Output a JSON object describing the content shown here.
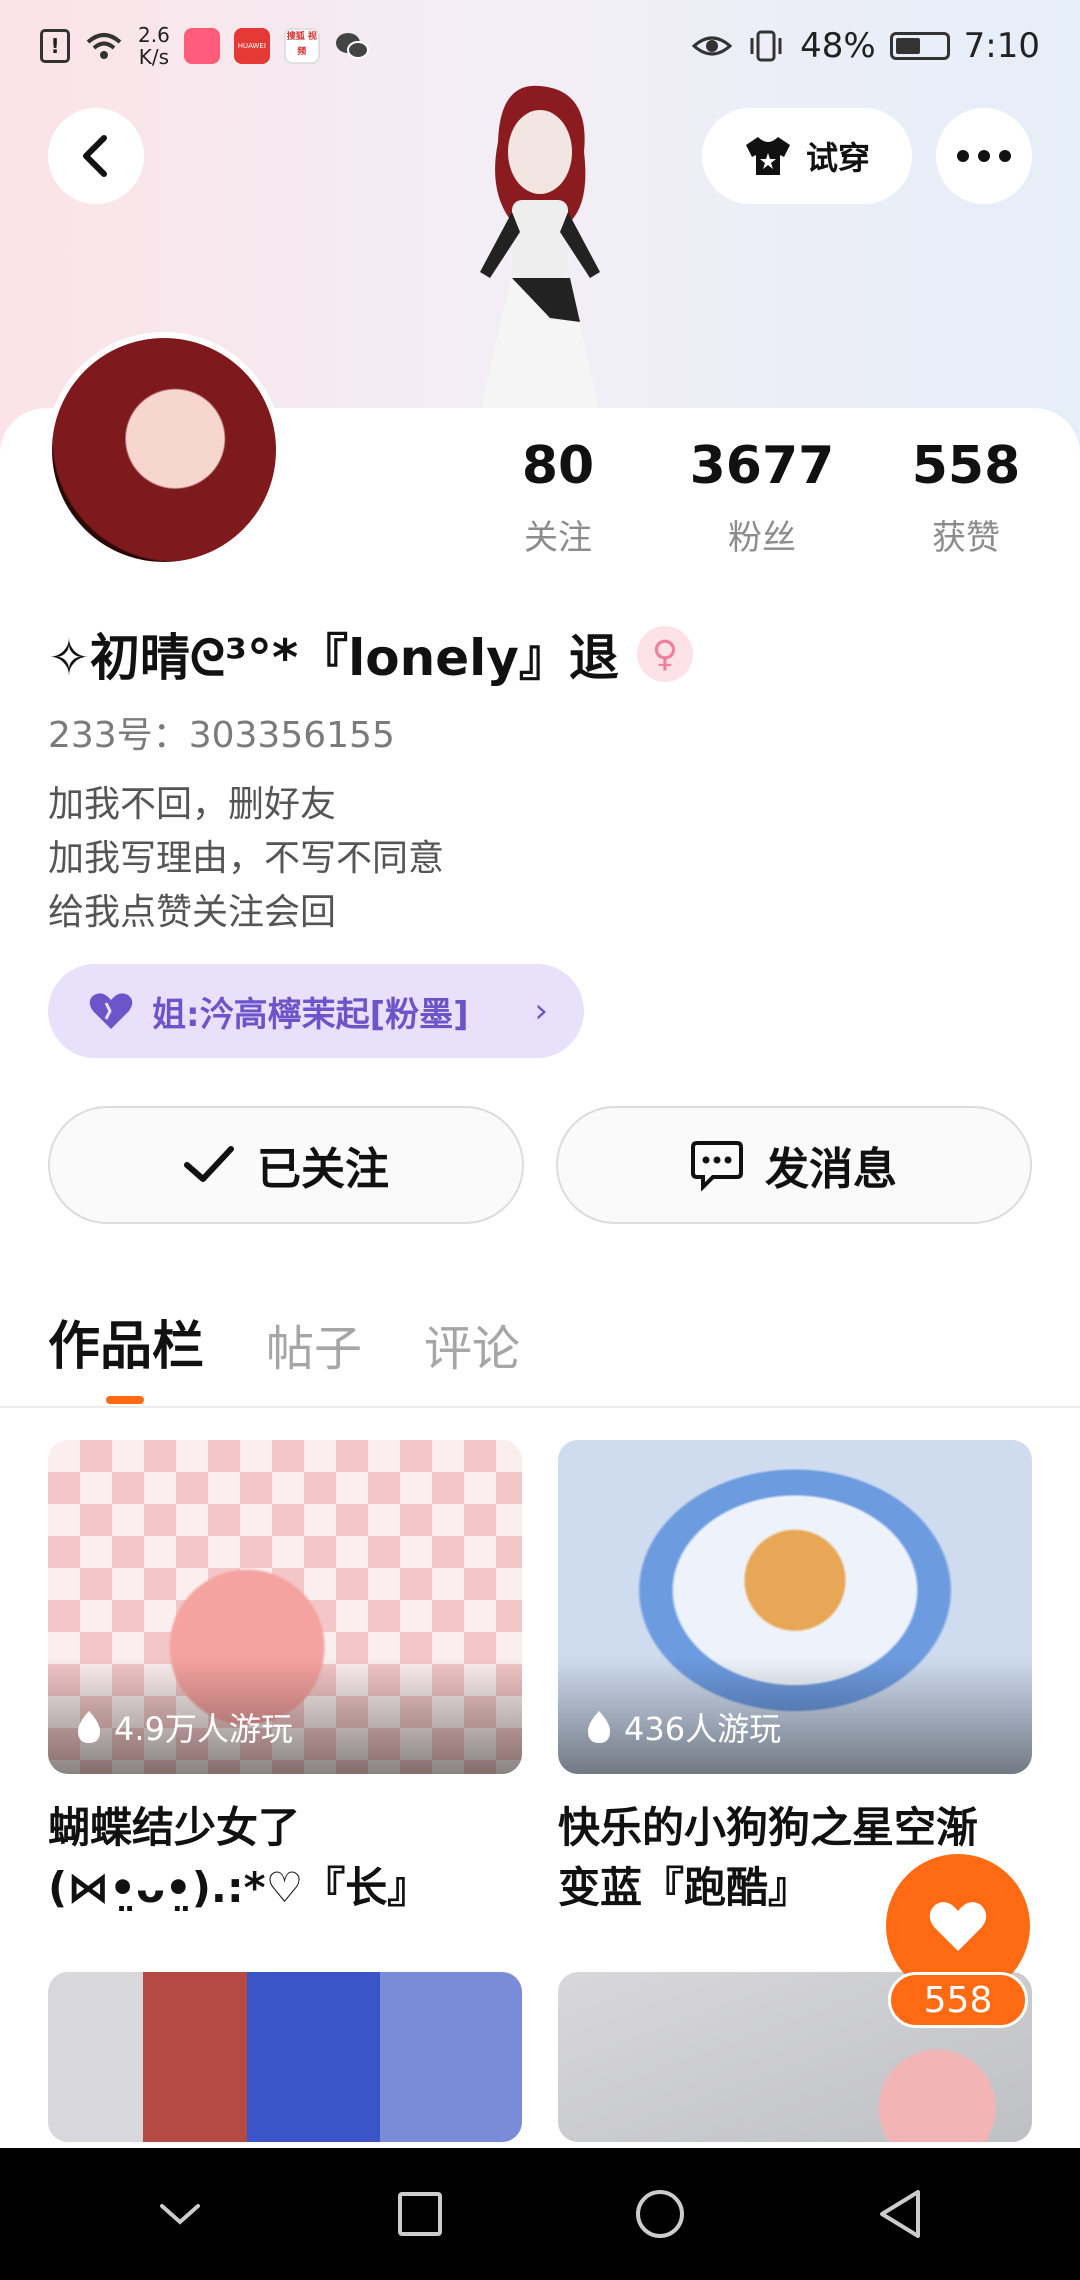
{
  "status_bar": {
    "network_speed_value": "2.6",
    "network_speed_unit": "K/s",
    "battery_percent": "48%",
    "time": "7:10",
    "app_labels": [
      "HUAWEI",
      "搜狐 视频"
    ]
  },
  "header": {
    "try_on_label": "试穿"
  },
  "profile": {
    "stats": [
      {
        "value": "80",
        "label": "关注"
      },
      {
        "value": "3677",
        "label": "粉丝"
      },
      {
        "value": "558",
        "label": "获赞"
      }
    ],
    "nickname": "✧初晴ᘓ³°*『lonely』退",
    "gender_symbol": "♀",
    "uid": "233号：303356155",
    "bio_lines": [
      "加我不回，删好友",
      "加我写理由，不写不同意",
      "给我点赞关注会回"
    ],
    "family_tag": "姐:汵高檸茉起[粉墨]"
  },
  "actions": {
    "follow_label": "已关注",
    "message_label": "发消息"
  },
  "tabs": [
    {
      "label": "作品栏",
      "active": true
    },
    {
      "label": "帖子",
      "active": false
    },
    {
      "label": "评论",
      "active": false
    }
  ],
  "works": [
    {
      "plays": "4.9万人游玩",
      "title_lines": [
        "蝴蝶结少女了",
        "(⋈•̤ᴗ•̤).:*♡『长』"
      ]
    },
    {
      "plays": "436人游玩",
      "title_lines": [
        "快乐的小狗狗之星空渐",
        "变蓝『跑酷』"
      ]
    }
  ],
  "like_fab": {
    "count": "558"
  },
  "colors": {
    "accent": "#ff6a13",
    "family_tag_bg": "#e8e1fb",
    "family_tag_text": "#6b56c9"
  }
}
